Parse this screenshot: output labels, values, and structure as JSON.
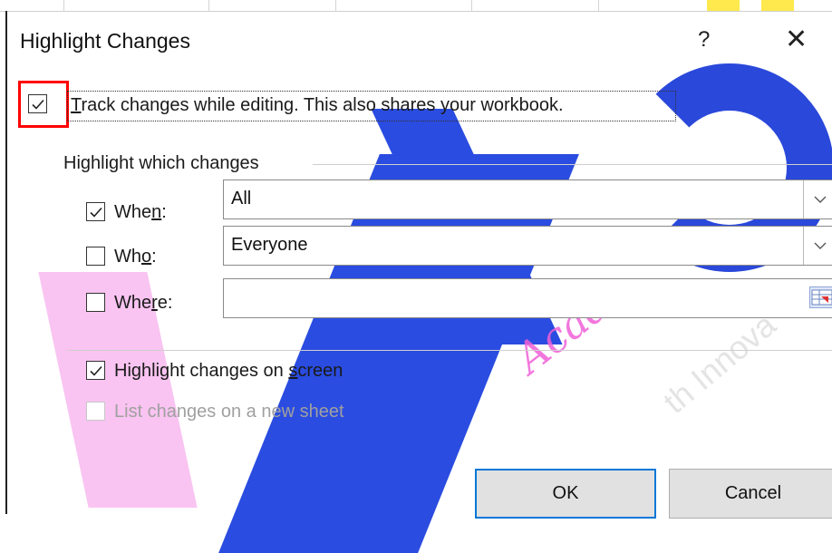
{
  "dialog": {
    "title": "Highlight Changes",
    "help_label": "?",
    "close_label": "✕",
    "track_changes": {
      "checked": true,
      "label_prefix": "T",
      "label_rest": "rack changes while editing. This also shares your workbook."
    },
    "group_title": "Highlight which changes",
    "when": {
      "checked": true,
      "label_a": "Whe",
      "label_u": "n",
      "label_b": ":",
      "value": "All"
    },
    "who": {
      "checked": false,
      "label_a": "Wh",
      "label_u": "o",
      "label_b": ":",
      "value": "Everyone"
    },
    "where": {
      "checked": false,
      "label_a": "Whe",
      "label_u": "r",
      "label_b": "e:",
      "value": ""
    },
    "highlight_on_screen": {
      "checked": true,
      "label_a": "Highlight changes on ",
      "label_u": "s",
      "label_b": "creen"
    },
    "list_new_sheet": {
      "checked": false,
      "enabled": false,
      "label": "List changes on a new sheet"
    },
    "ok_label": "OK",
    "cancel_label": "Cancel"
  },
  "watermark": {
    "script_text": "Acade",
    "text": "th Innova"
  },
  "colors": {
    "highlight_border": "#ff0000",
    "ok_border": "#0078d7",
    "watermark_blue": "#2a4ce0",
    "watermark_pink": "#f060d8"
  }
}
